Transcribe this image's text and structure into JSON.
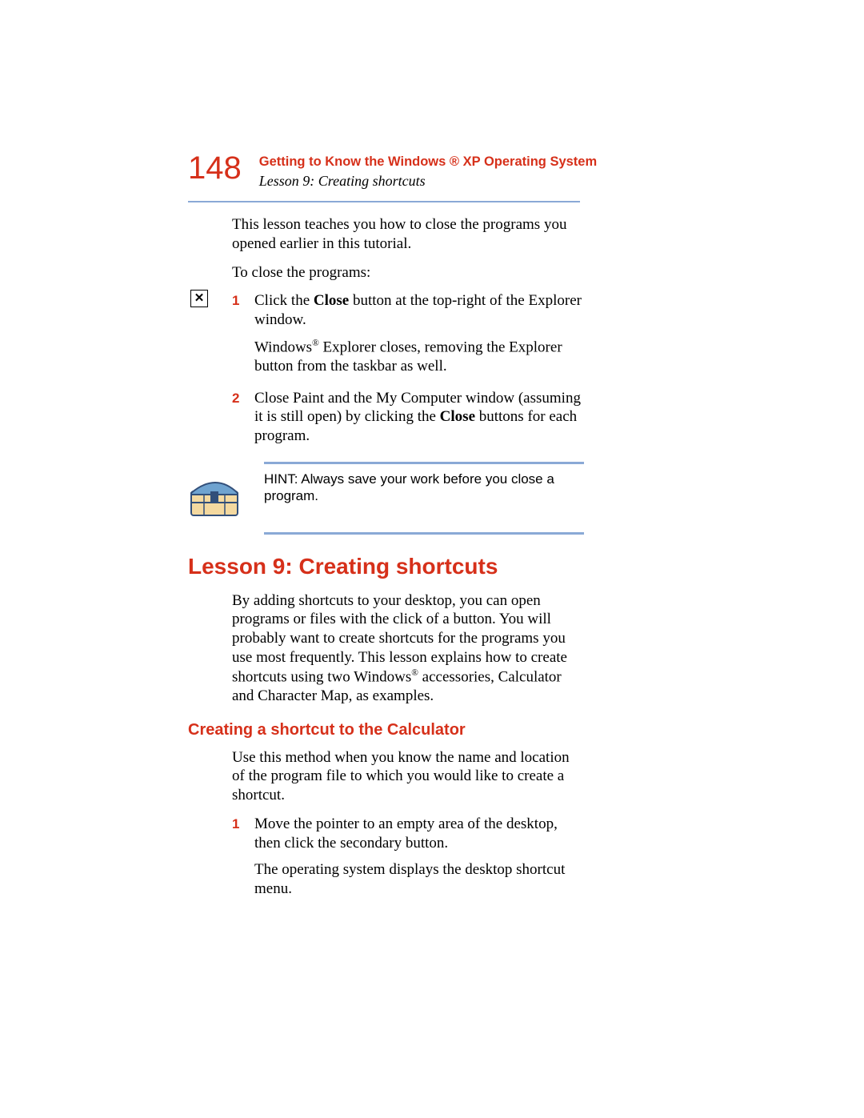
{
  "header": {
    "page_number": "148",
    "chapter_title": "Getting to Know the Windows ® XP Operating System",
    "section_title": "Lesson 9: Creating shortcuts"
  },
  "intro": {
    "p1": "This lesson teaches you how to close the programs you opened earlier in this tutorial.",
    "p2": "To close the programs:"
  },
  "closeSteps": {
    "s1": {
      "num": "1",
      "pre": "Click the ",
      "bold": "Close",
      "post": " button at the top-right of the Explorer window.",
      "follow": "Windows® Explorer closes, removing the Explorer button from the taskbar as well."
    },
    "s2": {
      "num": "2",
      "pre": "Close Paint and the My Computer window (assuming it is still open) by clicking the ",
      "bold": "Close",
      "post": " buttons for each program."
    }
  },
  "hint": {
    "text": "HINT: Always save your work before you close a program."
  },
  "lesson": {
    "heading": "Lesson 9: Creating shortcuts",
    "p1": "By adding shortcuts to your desktop, you can open programs or files with the click of a button. You will probably want to create shortcuts for the programs you use most frequently. This lesson explains how to create shortcuts using two Windows® accessories, Calculator and Character Map, as examples."
  },
  "calc": {
    "heading": "Creating a shortcut to the Calculator",
    "p1": "Use this method when you know the name and location of the program file to which you would like to create a shortcut.",
    "s1": {
      "num": "1",
      "text": "Move the pointer to an empty area of the desktop, then click the secondary button.",
      "follow": "The operating system displays the desktop shortcut menu."
    }
  },
  "icons": {
    "close_glyph": "✕"
  }
}
